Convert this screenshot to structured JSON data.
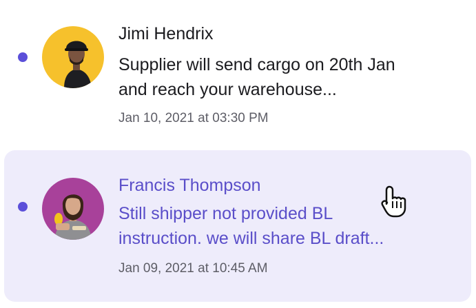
{
  "messages": [
    {
      "sender": "Jimi Hendrix",
      "preview_line1": "Supplier will send cargo on 20th Jan",
      "preview_line2": "and reach your warehouse...",
      "timestamp": "Jan 10, 2021 at 03:30 PM",
      "unread": true,
      "selected": false,
      "avatar_bg": "#f6c12c"
    },
    {
      "sender": "Francis Thompson",
      "preview_line1": "Still shipper not provided BL",
      "preview_line2": "instruction. we will share BL draft...",
      "timestamp": "Jan 09, 2021 at 10:45 AM",
      "unread": true,
      "selected": true,
      "avatar_bg": "#a8419a"
    }
  ],
  "colors": {
    "accent": "#5b4fd9",
    "selected_bg": "#eeecfb",
    "selected_text": "#5a4ec9",
    "text_primary": "#1b1b1f",
    "text_secondary": "#5d5d66"
  },
  "cursor": {
    "icon": "hand-pointer-icon"
  }
}
